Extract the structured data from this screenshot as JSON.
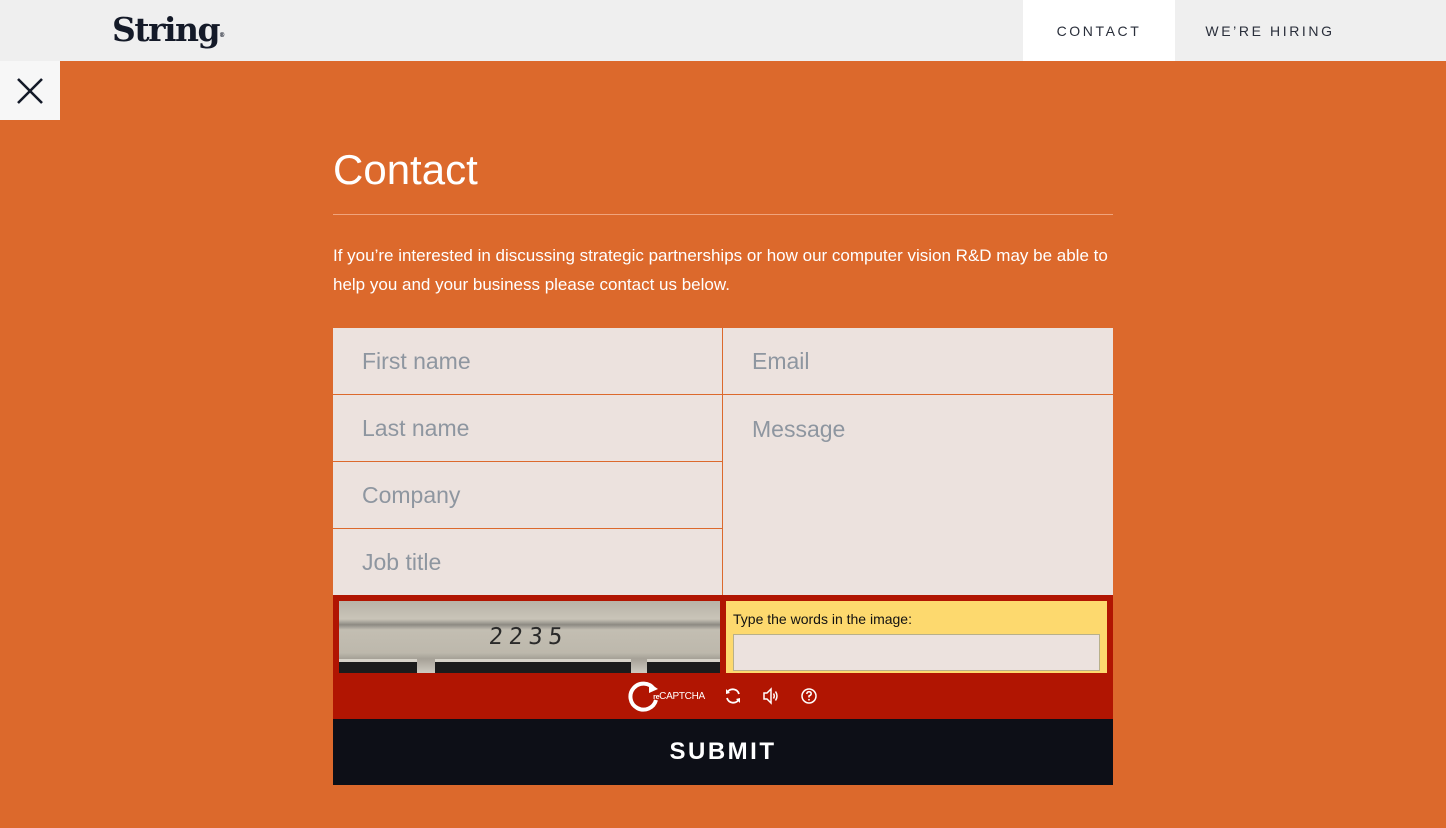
{
  "header": {
    "logo_text": "String",
    "logo_mark": "®",
    "nav": [
      {
        "label": "CONTACT",
        "active": true
      },
      {
        "label": "WE’RE HIRING",
        "active": false
      }
    ]
  },
  "overlay": {
    "close_icon": "close-icon",
    "background_color": "#dc692c"
  },
  "contact": {
    "title": "Contact",
    "intro": "If you’re interested in discussing strategic partnerships or how our computer vision R&D may be able to help you and your business please contact us below.",
    "fields": {
      "first_name": {
        "placeholder": "First name",
        "value": ""
      },
      "last_name": {
        "placeholder": "Last name",
        "value": ""
      },
      "company": {
        "placeholder": "Company",
        "value": ""
      },
      "job_title": {
        "placeholder": "Job title",
        "value": ""
      },
      "email": {
        "placeholder": "Email",
        "value": ""
      },
      "message": {
        "placeholder": "Message",
        "value": ""
      }
    },
    "captcha": {
      "image_text": "2235",
      "prompt": "Type the words in the image:",
      "logo_text": "CAPTCHA",
      "logo_prefix": "re",
      "icons": [
        "recaptcha-logo-icon",
        "refresh-icon",
        "audio-icon",
        "help-icon"
      ]
    },
    "submit_label": "SUBMIT"
  },
  "colors": {
    "accent": "#dc692c",
    "captcha_bg": "#b11502",
    "captcha_prompt_bg": "#fdd96e",
    "submit_bg": "#0d0f17",
    "field_bg": "#ece2de"
  }
}
